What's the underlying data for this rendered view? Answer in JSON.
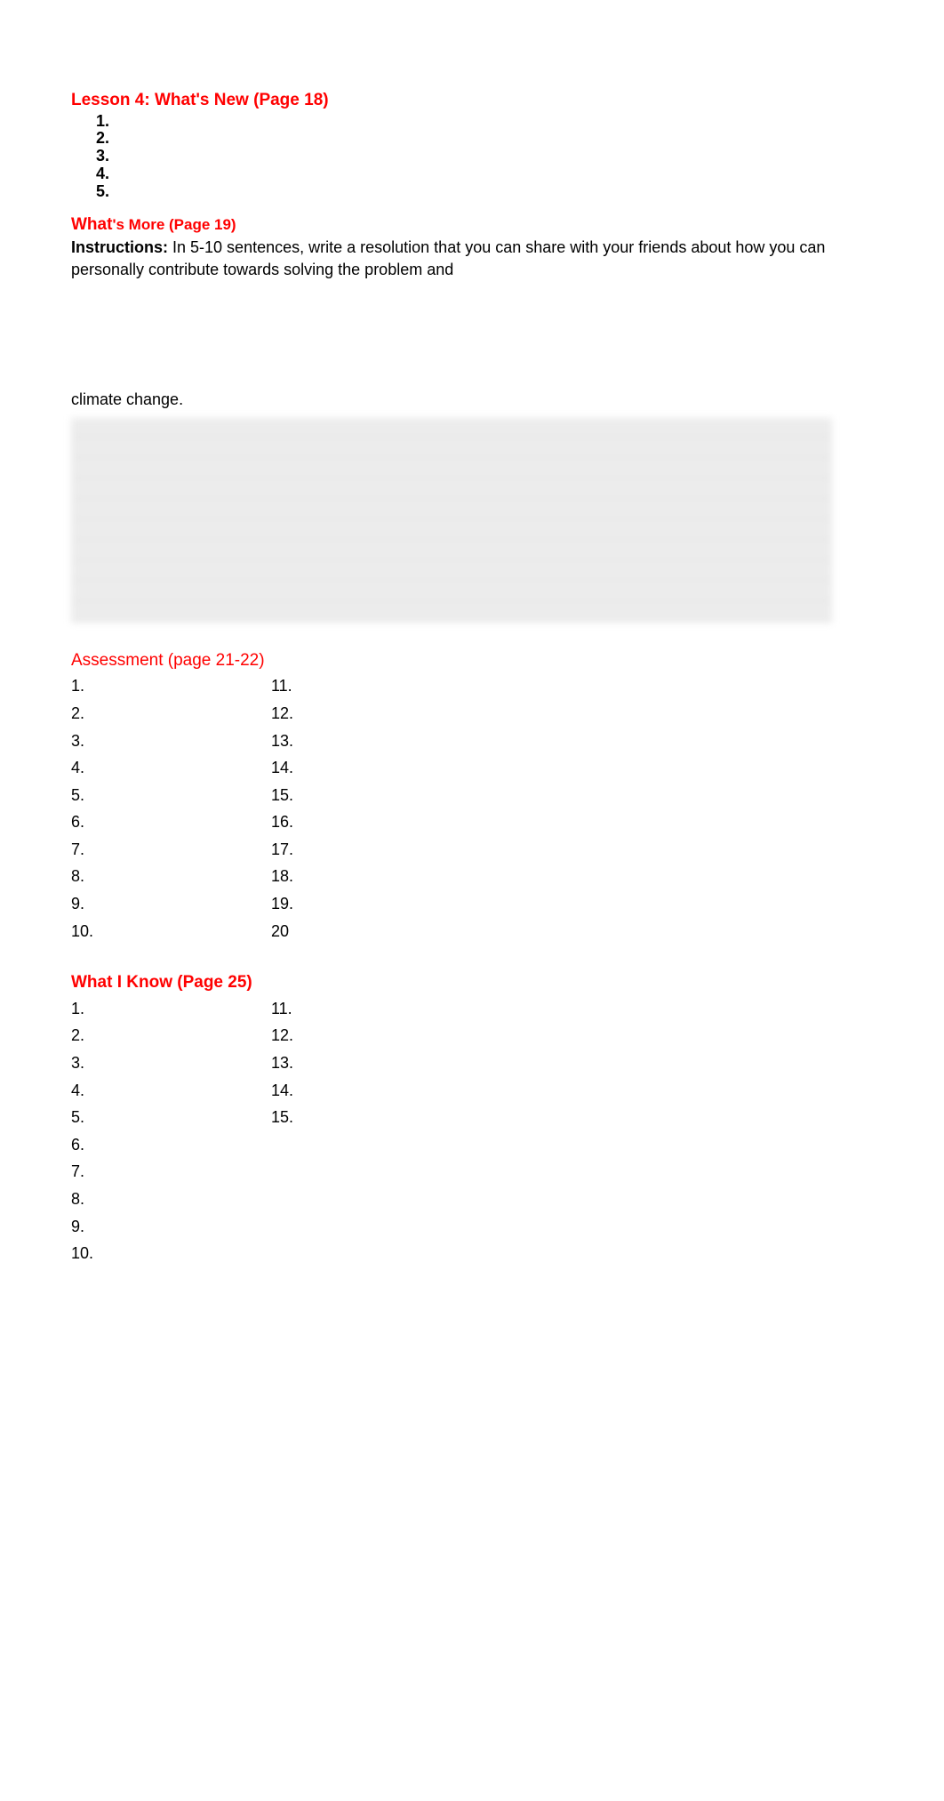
{
  "lesson4": {
    "title": "Lesson 4: What's New (Page 18)",
    "items": [
      "1.",
      "2.",
      "3.",
      "4.",
      "5."
    ]
  },
  "whatsMore": {
    "title_part1": "What",
    "title_part2": "'s More (Page 19)",
    "instr_label": "Instructions:",
    "instr_text": " In 5-10 sentences, write a resolution that you can share with your friends about how you can personally contribute towards solving the problem and",
    "climate_text": "climate change."
  },
  "assessment": {
    "title": "Assessment (page 21-22)",
    "col1": [
      "1.",
      "2.",
      "3.",
      "4.",
      "5.",
      "6.",
      "7.",
      "8.",
      "9.",
      "10."
    ],
    "col2": [
      "11.",
      "12.",
      "13.",
      "14.",
      "15.",
      "16.",
      "17.",
      "18.",
      "19.",
      "20"
    ]
  },
  "whatIKnow": {
    "title": "What I Know (Page 25)",
    "col1": [
      "1.",
      "2.",
      "3.",
      "4.",
      "5.",
      "6.",
      "7.",
      "8.",
      "9.",
      "10."
    ],
    "col2": [
      "11.",
      "12.",
      "13.",
      "14.",
      "15."
    ]
  }
}
